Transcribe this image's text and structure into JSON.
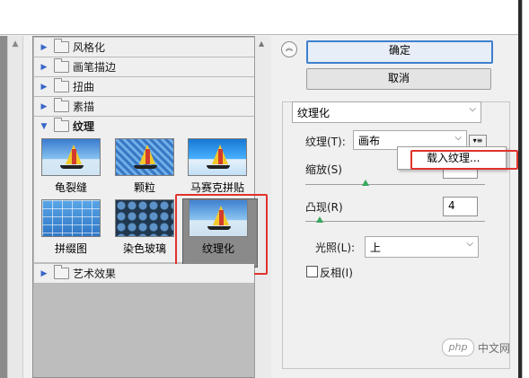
{
  "filters": {
    "categories": [
      {
        "label": "风格化",
        "expanded": false
      },
      {
        "label": "画笔描边",
        "expanded": false
      },
      {
        "label": "扭曲",
        "expanded": false
      },
      {
        "label": "素描",
        "expanded": false
      },
      {
        "label": "纹理",
        "expanded": true
      },
      {
        "label": "艺术效果",
        "expanded": false
      }
    ],
    "texture_items": [
      {
        "label": "龟裂缝"
      },
      {
        "label": "颗粒"
      },
      {
        "label": "马赛克拼贴"
      },
      {
        "label": "拼缀图"
      },
      {
        "label": "染色玻璃"
      },
      {
        "label": "纹理化",
        "selected": true
      }
    ]
  },
  "dialog": {
    "ok_label": "确定",
    "cancel_label": "取消",
    "filter_select": "纹理化",
    "texture_label": "纹理(T):",
    "texture_value": "画布",
    "load_texture_label": "载入纹理...",
    "scale_label": "缩放(S)",
    "relief_label": "凸现(R)",
    "relief_value": "4",
    "light_label": "光照(L):",
    "light_value": "上",
    "invert_label": "反相(I)",
    "invert_checked": false
  },
  "watermark": {
    "logo": "php",
    "text": "中文网"
  },
  "colors": {
    "highlight_red": "#e0322d",
    "primary_blue": "#3f7fcf",
    "slider_green": "#38a85e"
  }
}
